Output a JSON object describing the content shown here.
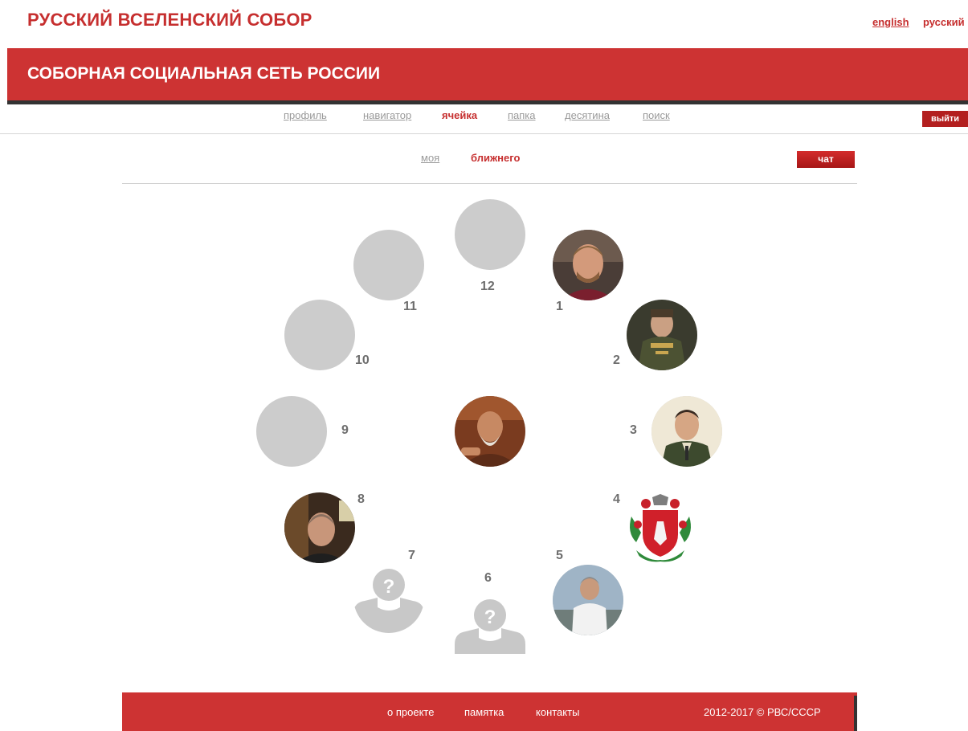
{
  "site": {
    "title": "РУССКИЙ ВСЕЛЕНСКИЙ СОБОР",
    "lang_en": "english",
    "lang_ru": "русский"
  },
  "banner": {
    "title": "СОБОРНАЯ СОЦИАЛЬНАЯ СЕТЬ РОССИИ"
  },
  "nav": {
    "items": [
      "профиль",
      "навигатор",
      "ячейка",
      "папка",
      "десятина",
      "поиск"
    ],
    "active": "ячейка",
    "logout": "выйти"
  },
  "subnav": {
    "mine": "моя",
    "neighbor": "ближнего",
    "active": "ближнего",
    "chat": "чат"
  },
  "cell": {
    "slots": [
      {
        "number": "1",
        "state": "photo"
      },
      {
        "number": "2",
        "state": "photo"
      },
      {
        "number": "3",
        "state": "photo"
      },
      {
        "number": "4",
        "state": "emblem"
      },
      {
        "number": "5",
        "state": "photo"
      },
      {
        "number": "6",
        "state": "unknown"
      },
      {
        "number": "7",
        "state": "unknown"
      },
      {
        "number": "8",
        "state": "photo"
      },
      {
        "number": "9",
        "state": "empty"
      },
      {
        "number": "10",
        "state": "empty"
      },
      {
        "number": "11",
        "state": "empty"
      },
      {
        "number": "12",
        "state": "empty"
      }
    ],
    "center": {
      "state": "photo"
    }
  },
  "footer": {
    "about": "о проекте",
    "memo": "памятка",
    "contacts": "контакты",
    "copyright": "2012-2017 © РВС/СССР"
  },
  "colors": {
    "brand_red": "#cd3333",
    "link_red": "#c62f2f",
    "placeholder_grey": "#cccccc",
    "muted_link": "#9a9a9a"
  }
}
